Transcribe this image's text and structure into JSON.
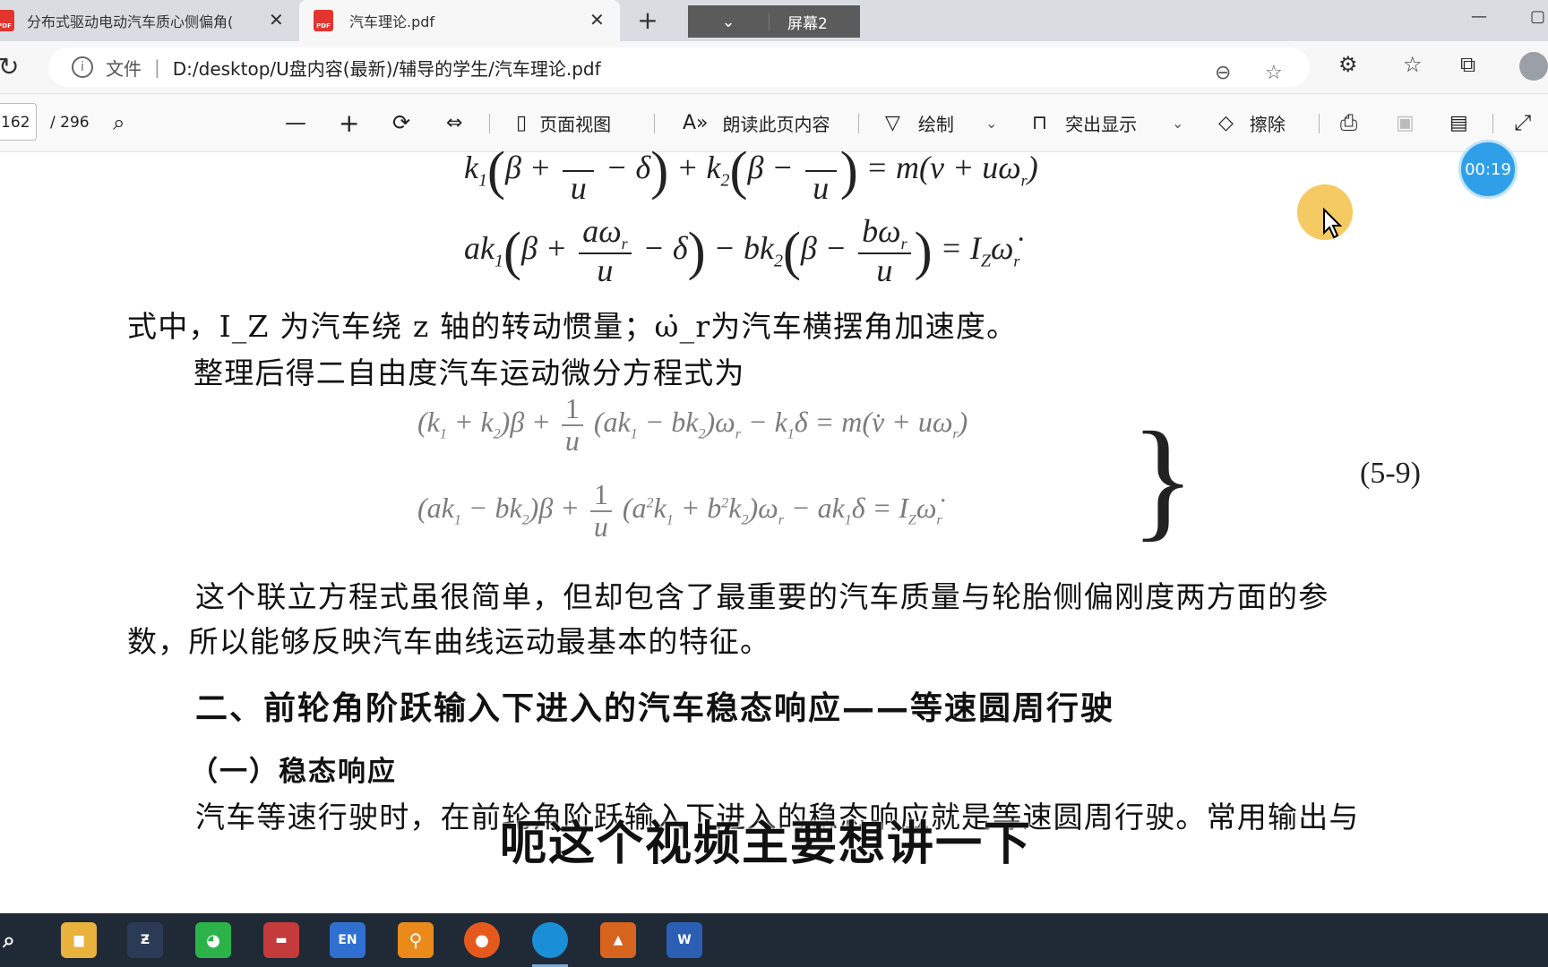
{
  "tabs": [
    {
      "title": "分布式驱动电动汽车质心侧偏角(",
      "icon": "pdf-icon",
      "active": false
    },
    {
      "title": "汽车理论.pdf",
      "icon": "pdf-icon",
      "active": true
    }
  ],
  "screen_selector": {
    "label": "屏幕2"
  },
  "address": {
    "file_label": "文件",
    "url": "D:/desktop/U盘内容(最新)/辅导的学生/汽车理论.pdf"
  },
  "pdf_toolbar": {
    "page_current": "162",
    "page_total": "/ 296",
    "page_view": "页面视图",
    "read_aloud": "朗读此页内容",
    "draw": "绘制",
    "highlight": "突出显示",
    "erase": "擦除"
  },
  "timer": "00:19",
  "document": {
    "eq_top": {
      "k1": "k",
      "lhs_partial": "k₁(β + ── − δ) + k₂(β − ── ) = m(v + uω_r)"
    },
    "eq2": {
      "pre": "ak",
      "a_omega": "aω",
      "u": "u",
      "b_omega": "bω",
      "rhs": "= I"
    },
    "line1": "式中，I_Z 为汽车绕 z 轴的转动惯量；ω̇_r为汽车横摆角加速度。",
    "line2": "整理后得二自由度汽车运动微分方程式为",
    "eq3_row1": "(k₁ + k₂)β + ── (ak₁ − bk₂)ω_r − k₁δ = m(v̇ + uω_r)",
    "eq3_row2": "(ak₁ − bk₂)β + ── (a²k₁ + b²k₂)ω_r − ak₁δ = I_Z ω̇_r",
    "eq_number": "(5-9)",
    "para1_line1": "这个联立方程式虽很简单，但却包含了最重要的汽车质量与轮胎侧偏刚度两方面的参",
    "para1_line2": "数，所以能够反映汽车曲线运动最基本的特征。",
    "heading2": "二、前轮角阶跃输入下进入的汽车稳态响应——等速圆周行驶",
    "heading3": "（一）稳态响应",
    "para2": "汽车等速行驶时，在前轮角阶跃输入下进入的稳态响应就是等速圆周行驶。常用输出与"
  },
  "video_subtitle": "呃这个视频主要想讲一下",
  "taskbar_apps": [
    "search-icon",
    "file-explorer-icon",
    "app-icon",
    "wechat-icon",
    "car-app-icon",
    "en-dictionary-icon",
    "search-tool-icon",
    "firefox-icon",
    "edge-icon",
    "matlab-icon",
    "word-icon"
  ],
  "colors": {
    "accent": "#2f9fea",
    "taskbar": "#1f2a36",
    "highlight": "#f5c451"
  }
}
